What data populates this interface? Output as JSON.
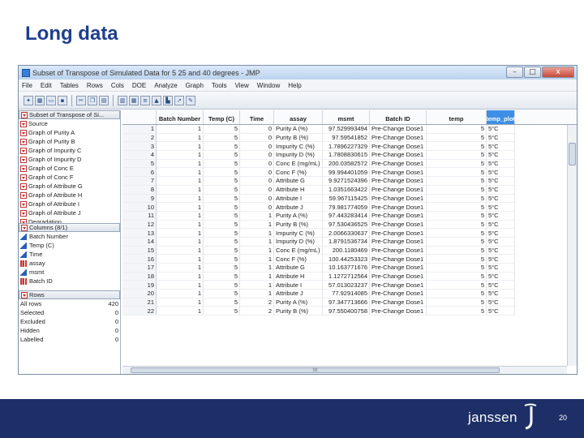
{
  "slide": {
    "title": "Long data",
    "page_number": "20",
    "logo_text": "janssen"
  },
  "window": {
    "title": "Subset of Transpose of Simulated Data for 5 25 and 40 degrees - JMP",
    "buttons": {
      "minimize": "–",
      "maximize": "□",
      "close": "x"
    }
  },
  "menu": [
    "File",
    "Edit",
    "Tables",
    "Rows",
    "Cols",
    "DOE",
    "Analyze",
    "Graph",
    "Tools",
    "View",
    "Window",
    "Help"
  ],
  "left_panel": {
    "table_name": "Subset of Transpose of Si...",
    "scripts": [
      "Source",
      "Graph of Purity A",
      "Graph of Purity B",
      "Graph of Impurity C",
      "Graph of Impurity D",
      "Graph of Conc E",
      "Graph of Conc F",
      "Graph of Attribute G",
      "Graph of Attribute H",
      "Graph of Attribute I",
      "Graph of Attribute J",
      "Degradation"
    ],
    "columns_header": "Columns (8/1)",
    "columns": [
      {
        "name": "Batch Number",
        "type": "blue"
      },
      {
        "name": "Temp (C)",
        "type": "blue"
      },
      {
        "name": "Time",
        "type": "blue"
      },
      {
        "name": "assay",
        "type": "red"
      },
      {
        "name": "msmt",
        "type": "blue"
      },
      {
        "name": "Batch ID",
        "type": "red"
      }
    ],
    "rows_header": "Rows",
    "rows_stats": [
      {
        "label": "All rows",
        "value": "420"
      },
      {
        "label": "Selected",
        "value": "0"
      },
      {
        "label": "Excluded",
        "value": "0"
      },
      {
        "label": "Hidden",
        "value": "0"
      },
      {
        "label": "Labelled",
        "value": "0"
      }
    ]
  },
  "grid": {
    "headers": [
      "",
      "Batch Number",
      "Temp (C)",
      "Time",
      "assay",
      "msmt",
      "Batch ID",
      "temp",
      "temp_plot"
    ],
    "rows": [
      [
        "1",
        "1",
        "5",
        "0",
        "Purity A (%)",
        "97.529993494",
        "Pre-Change Dose1",
        "5",
        "5°C"
      ],
      [
        "2",
        "1",
        "5",
        "0",
        "Purity B (%)",
        "97.59541852",
        "Pre-Change Dose1",
        "5",
        "5°C"
      ],
      [
        "3",
        "1",
        "5",
        "0",
        "Impurity C (%)",
        "1.7896227329",
        "Pre-Change Dose1",
        "5",
        "5°C"
      ],
      [
        "4",
        "1",
        "5",
        "0",
        "Impurity D (%)",
        "1.7808830615",
        "Pre-Change Dose1",
        "5",
        "5°C"
      ],
      [
        "5",
        "1",
        "5",
        "0",
        "Conc E (mg/mL)",
        "200.03582572",
        "Pre-Change Dose1",
        "5",
        "5°C"
      ],
      [
        "6",
        "1",
        "5",
        "0",
        "Conc F (%)",
        "99.994401059",
        "Pre-Change Dose1",
        "5",
        "5°C"
      ],
      [
        "7",
        "1",
        "5",
        "0",
        "Attribute G",
        "9.9271524396",
        "Pre-Change Dose1",
        "5",
        "5°C"
      ],
      [
        "8",
        "1",
        "5",
        "0",
        "Attribute H",
        "1.0351663422",
        "Pre-Change Dose1",
        "5",
        "5°C"
      ],
      [
        "9",
        "1",
        "5",
        "0",
        "Attribute I",
        "59.967115425",
        "Pre-Change Dose1",
        "5",
        "5°C"
      ],
      [
        "10",
        "1",
        "5",
        "0",
        "Attribute J",
        "79.981774059",
        "Pre-Change Dose1",
        "5",
        "5°C"
      ],
      [
        "11",
        "1",
        "5",
        "1",
        "Purity A (%)",
        "97.443283414",
        "Pre-Change Dose1",
        "5",
        "5°C"
      ],
      [
        "12",
        "1",
        "5",
        "1",
        "Purity B (%)",
        "97.530436525",
        "Pre-Change Dose1",
        "5",
        "5°C"
      ],
      [
        "13",
        "1",
        "5",
        "1",
        "Impurity C (%)",
        "2.0066330637",
        "Pre-Change Dose1",
        "5",
        "5°C"
      ],
      [
        "14",
        "1",
        "5",
        "1",
        "Impurity D (%)",
        "1.8791536734",
        "Pre-Change Dose1",
        "5",
        "5°C"
      ],
      [
        "15",
        "1",
        "5",
        "1",
        "Conc E (mg/mL)",
        "200.1180469",
        "Pre-Change Dose1",
        "5",
        "5°C"
      ],
      [
        "16",
        "1",
        "5",
        "1",
        "Conc F (%)",
        "100.44253323",
        "Pre-Change Dose1",
        "5",
        "5°C"
      ],
      [
        "17",
        "1",
        "5",
        "1",
        "Attribute G",
        "10.163771676",
        "Pre-Change Dose1",
        "5",
        "5°C"
      ],
      [
        "18",
        "1",
        "5",
        "1",
        "Attribute H",
        "1.1272712564",
        "Pre-Change Dose1",
        "5",
        "5°C"
      ],
      [
        "19",
        "1",
        "5",
        "1",
        "Attribute I",
        "57.013023237",
        "Pre-Change Dose1",
        "5",
        "5°C"
      ],
      [
        "20",
        "1",
        "5",
        "1",
        "Attribute J",
        "77.92914085",
        "Pre-Change Dose1",
        "5",
        "5°C"
      ],
      [
        "21",
        "1",
        "5",
        "2",
        "Purity A (%)",
        "97.347713666",
        "Pre-Change Dose1",
        "5",
        "5°C"
      ],
      [
        "22",
        "1",
        "5",
        "2",
        "Purity B (%)",
        "97.550400758",
        "Pre-Change Dose1",
        "5",
        "5°C"
      ]
    ]
  },
  "scrollbar": {
    "h_thumb": "III"
  }
}
